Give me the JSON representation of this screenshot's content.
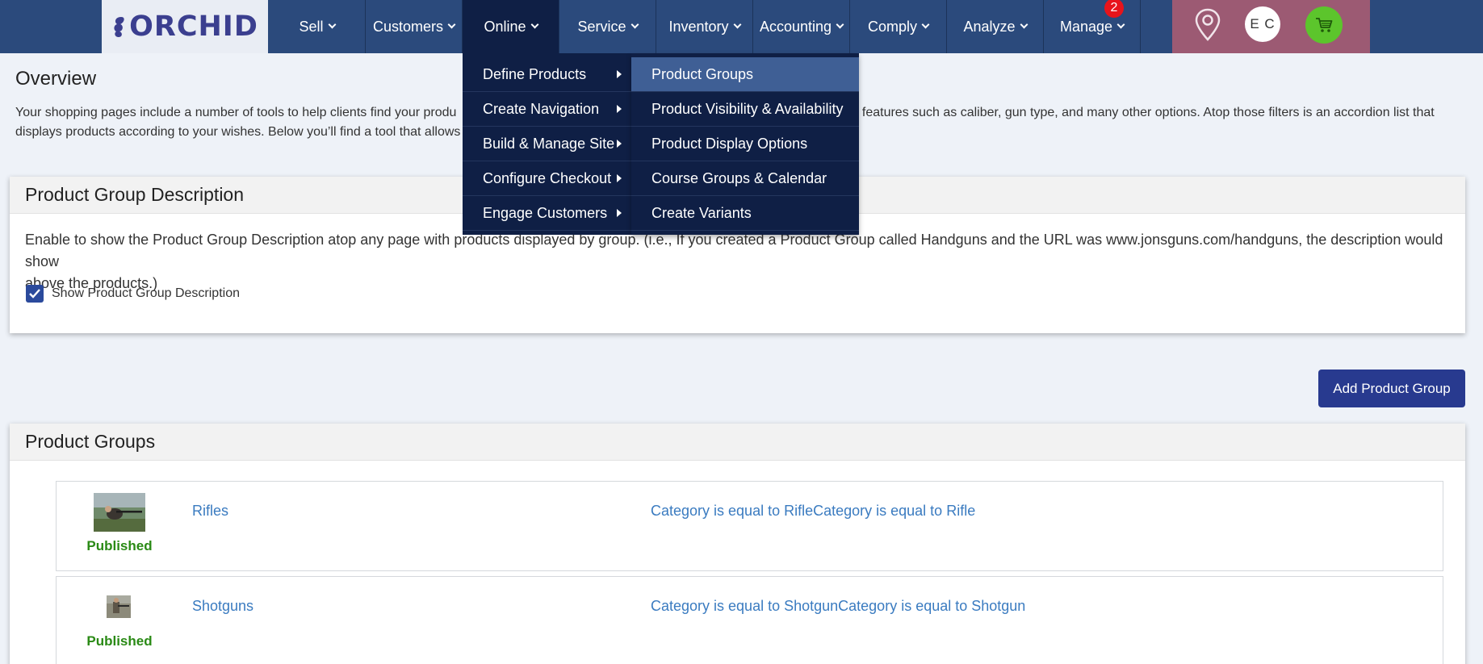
{
  "brand": {
    "logo_text": "ORCHID"
  },
  "nav": {
    "items": [
      {
        "label": "Sell"
      },
      {
        "label": "Customers"
      },
      {
        "label": "Online"
      },
      {
        "label": "Service"
      },
      {
        "label": "Inventory"
      },
      {
        "label": "Accounting"
      },
      {
        "label": "Comply"
      },
      {
        "label": "Analyze"
      },
      {
        "label": "Manage"
      }
    ],
    "active": "Online",
    "manage_badge": "2"
  },
  "user": {
    "initials": "E C"
  },
  "icons": {
    "location": "map-pin-icon",
    "cart": "cart-icon",
    "dropdown": "chevron-down-icon",
    "submenu": "caret-right-icon",
    "checkbox": "checkmark-icon"
  },
  "colors": {
    "nav_bg": "#2b4a7c",
    "menu_bg": "#0f1f45",
    "menu_highlight": "#3f5f95",
    "accent_button": "#283a8f",
    "published": "#2a8a15",
    "link": "#3a7bc0"
  },
  "dropdown": {
    "left": [
      {
        "label": "Define Products"
      },
      {
        "label": "Create Navigation"
      },
      {
        "label": "Build & Manage Site"
      },
      {
        "label": "Configure Checkout"
      },
      {
        "label": "Engage Customers"
      }
    ],
    "right": [
      {
        "label": "Product Groups"
      },
      {
        "label": "Product Visibility & Availability"
      },
      {
        "label": "Product Display Options"
      },
      {
        "label": "Course Groups & Calendar"
      },
      {
        "label": "Create Variants"
      }
    ],
    "highlighted": "Product Groups"
  },
  "overview": {
    "title": "Overview",
    "text_line1_a": "Your shopping pages include a number of tools to help clients find your produ",
    "text_line1_b": "y features such as caliber, gun type, and many other options. Atop those filters is an accordion list that",
    "text_line2": "displays products according to your wishes. Below you’ll find a tool that allows"
  },
  "pgd": {
    "title": "Product Group Description",
    "text_a": "Enable to show the Product Group Description atop any page with produ",
    "text_b": "cts displayed by group. (i.e., If you created a Product Group called Handguns and the URL was www.jonsguns.com/handguns, the description would show",
    "text_c": "above the products.)",
    "checkbox_label": "Show Product Group Description",
    "checked": true
  },
  "add_button": {
    "label": "Add Product Group"
  },
  "product_groups": {
    "title": "Product Groups",
    "rows": [
      {
        "name": "Rifles",
        "status": "Published",
        "filter": "Category is equal to RifleCategory is equal to Rifle"
      },
      {
        "name": "Shotguns",
        "status": "Published",
        "filter": "Category is equal to ShotgunCategory is equal to Shotgun"
      }
    ]
  }
}
